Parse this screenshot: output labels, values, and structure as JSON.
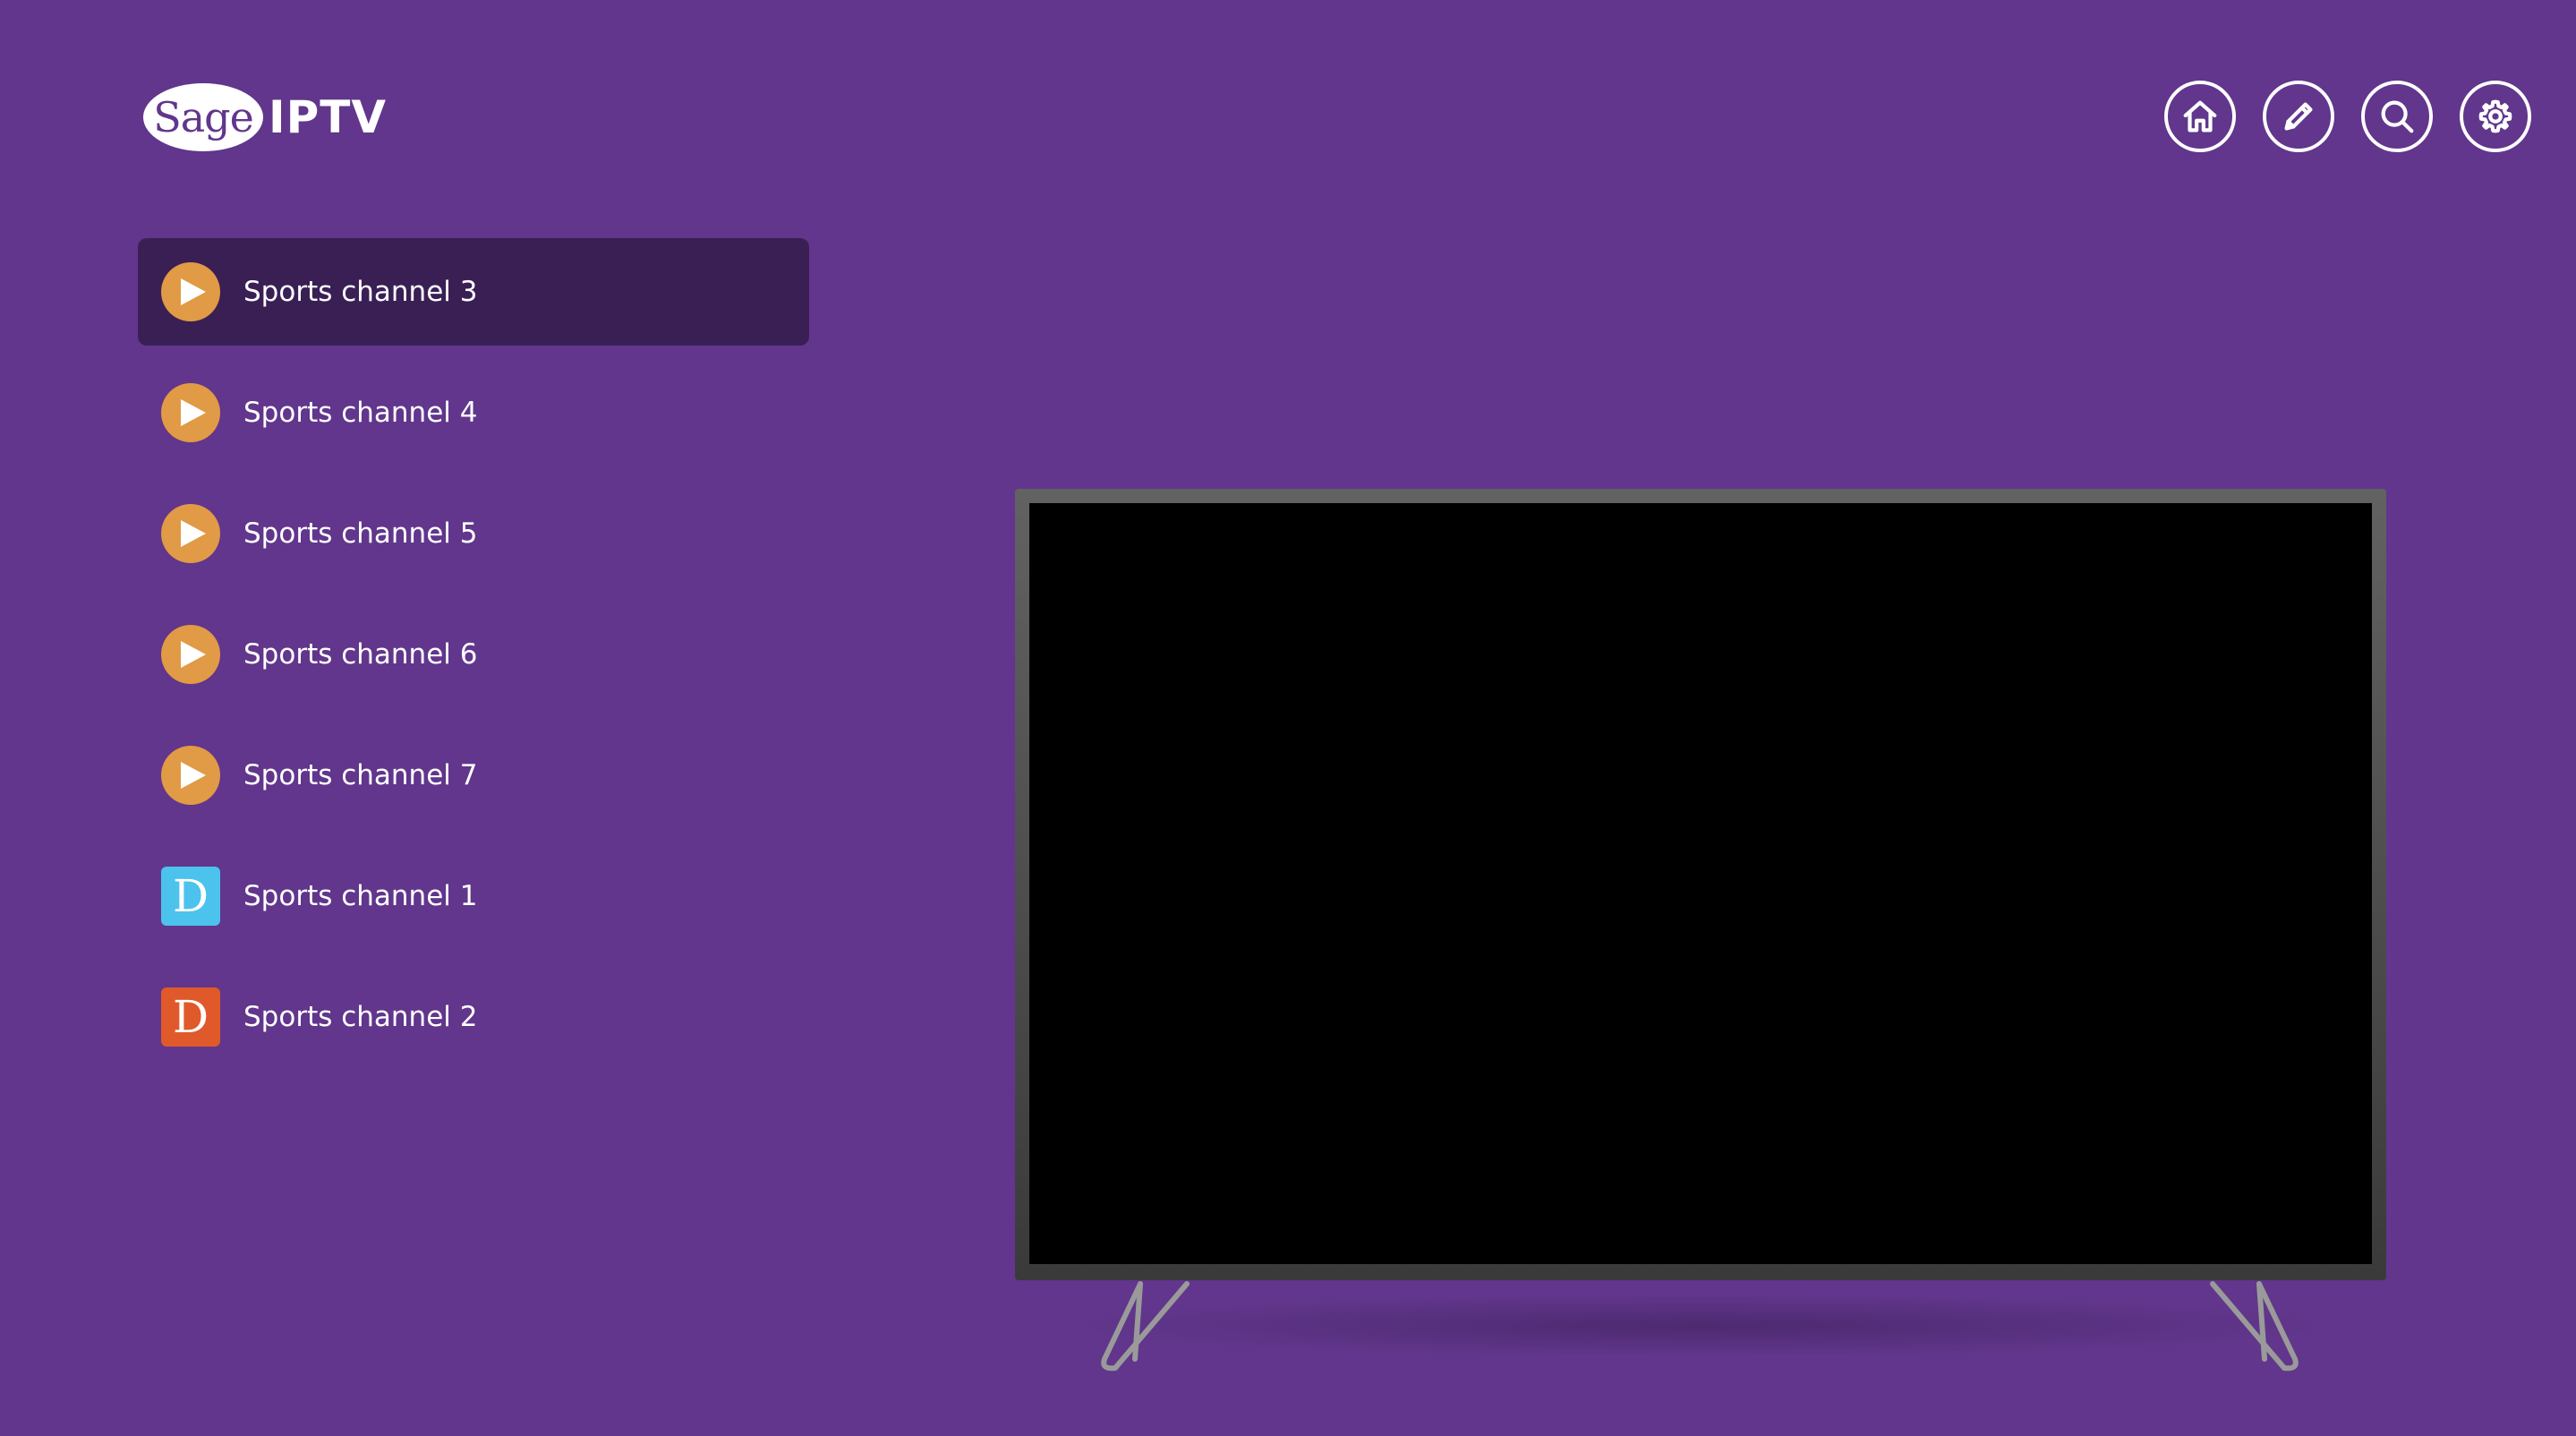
{
  "header": {
    "logo": {
      "brand": "Sage",
      "product": "IPTV"
    },
    "toolbar": [
      {
        "id": "home",
        "icon": "home-icon"
      },
      {
        "id": "edit",
        "icon": "pencil-icon"
      },
      {
        "id": "search",
        "icon": "search-icon"
      },
      {
        "id": "settings",
        "icon": "gear-icon"
      }
    ]
  },
  "channels": [
    {
      "label": "Sports channel 3",
      "icon": "play-icon",
      "selected": true
    },
    {
      "label": "Sports channel 4",
      "icon": "play-icon",
      "selected": false
    },
    {
      "label": "Sports channel 5",
      "icon": "play-icon",
      "selected": false
    },
    {
      "label": "Sports channel 6",
      "icon": "play-icon",
      "selected": false
    },
    {
      "label": "Sports channel 7",
      "icon": "play-icon",
      "selected": false
    },
    {
      "label": "Sports channel 1",
      "icon": "letter-d-logo",
      "letter": "D",
      "color": "#4cc3ec",
      "selected": false
    },
    {
      "label": "Sports channel 2",
      "icon": "letter-d-logo",
      "letter": "D",
      "color": "#e0592a",
      "selected": false
    }
  ],
  "colors": {
    "background": "#61368c",
    "selected_row": "#3a1f55",
    "play_accent": "#e19a45"
  }
}
